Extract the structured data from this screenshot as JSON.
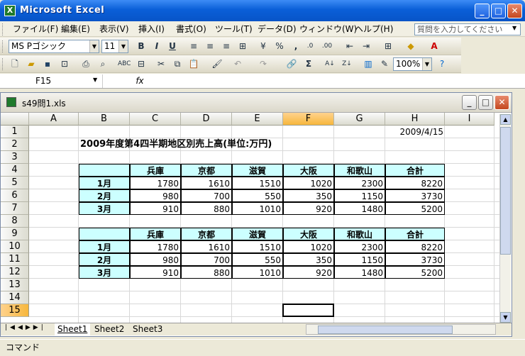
{
  "window": {
    "title": "Microsoft Excel"
  },
  "menu": [
    "ファイル(F)",
    "編集(E)",
    "表示(V)",
    "挿入(I)",
    "書式(O)",
    "ツール(T)",
    "データ(D)",
    "ウィンドウ(W)",
    "ヘルプ(H)"
  ],
  "help_placeholder": "質問を入力してください",
  "formatting": {
    "font": "MS Pゴシック",
    "size": "11"
  },
  "standard": {
    "zoom": "100%"
  },
  "formula_bar": {
    "name_box": "F15",
    "fx": "fx",
    "content": ""
  },
  "workbook": {
    "title": "s49問1.xls"
  },
  "columns": [
    "A",
    "B",
    "C",
    "D",
    "E",
    "F",
    "G",
    "H",
    "I"
  ],
  "selected_column": "F",
  "rows": [
    "1",
    "2",
    "3",
    "4",
    "5",
    "6",
    "7",
    "8",
    "9",
    "10",
    "11",
    "12",
    "13",
    "14",
    "15"
  ],
  "selected_row": "15",
  "cells": {
    "date": "2009/4/15",
    "heading": "2009年度第4四半期地区別売上高(単位:万円)"
  },
  "table_headers": [
    "兵庫",
    "京都",
    "滋賀",
    "大阪",
    "和歌山",
    "合計"
  ],
  "table1": [
    {
      "label": "1月",
      "values": [
        "1780",
        "1610",
        "1510",
        "1020",
        "2300",
        "8220"
      ]
    },
    {
      "label": "2月",
      "values": [
        "980",
        "700",
        "550",
        "350",
        "1150",
        "3730"
      ]
    },
    {
      "label": "3月",
      "values": [
        "910",
        "880",
        "1010",
        "920",
        "1480",
        "5200"
      ]
    }
  ],
  "table2": [
    {
      "label": "1月",
      "values": [
        "1780",
        "1610",
        "1510",
        "1020",
        "2300",
        "8220"
      ]
    },
    {
      "label": "2月",
      "values": [
        "980",
        "700",
        "550",
        "350",
        "1150",
        "3730"
      ]
    },
    {
      "label": "3月",
      "values": [
        "910",
        "880",
        "1010",
        "920",
        "1480",
        "5200"
      ]
    }
  ],
  "sheet_tabs": [
    "Sheet1",
    "Sheet2",
    "Sheet3"
  ],
  "active_sheet": "Sheet1",
  "status": "コマンド"
}
